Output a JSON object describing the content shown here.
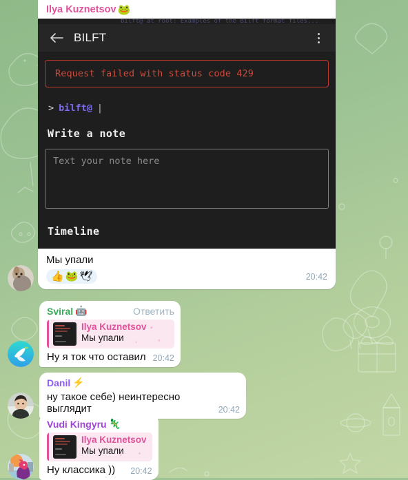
{
  "app_message": {
    "sender": "Ilya Kuznetsov",
    "sender_emoji": "🐸",
    "ghost_line": "bilft@ at root: Examples of the Bilft format files...",
    "webapp": {
      "title": "BILFT",
      "back_icon": "back-arrow-icon",
      "menu_icon": "more-vertical-icon",
      "error_text": "Request failed with status code 429",
      "prompt_symbol": ">",
      "prompt_user": "bilft@",
      "prompt_cursor": "|",
      "note_heading": "Write a note",
      "note_placeholder": "Text your note here",
      "note_value": "",
      "timeline_heading": "Timeline"
    },
    "text": "Мы упали",
    "reactions": [
      "👍",
      "🐸",
      "🕊"
    ],
    "time": "20:42"
  },
  "messages": [
    {
      "sender": "Sviral",
      "sender_emoji": "🤖",
      "name_color": "green",
      "reply_label": "Ответить",
      "quote": {
        "name": "Ilya Kuznetsov",
        "text": "Мы упали"
      },
      "text": "Ну я ток что оставил",
      "time": "20:42",
      "avatar": "dove-avatar"
    },
    {
      "sender": "Danil",
      "sender_emoji": "⚡",
      "name_color": "purple",
      "reply_label": "",
      "quote": null,
      "text": "ну такое себе) неинтересно выглядит",
      "time": "20:42",
      "avatar": "photo-avatar-danil"
    },
    {
      "sender": "Vudi Kingyru",
      "sender_emoji": "🦎",
      "name_color": "violet",
      "reply_label": "",
      "quote": {
        "name": "Ilya Kuznetsov",
        "text": "Мы упали"
      },
      "text": "Ну классика ))",
      "time": "20:42",
      "avatar": "dragon-avatar"
    }
  ],
  "colors": {
    "accent_pink": "#e0529c",
    "wallpaper_green": "#9cc294",
    "error_red": "#cc4b3d",
    "prompt_purple": "#7b6cf0",
    "timestamp_gray": "#8fa6b6"
  }
}
